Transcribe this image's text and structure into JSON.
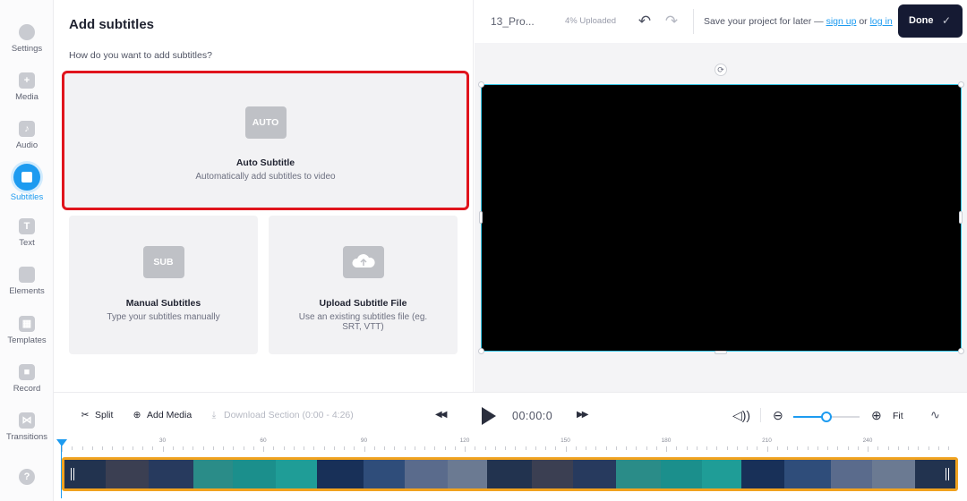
{
  "nav": {
    "items": [
      {
        "label": "Settings"
      },
      {
        "label": "Media"
      },
      {
        "label": "Audio"
      },
      {
        "label": "Subtitles"
      },
      {
        "label": "Text"
      },
      {
        "label": "Elements"
      },
      {
        "label": "Templates"
      },
      {
        "label": "Record"
      },
      {
        "label": "Transitions"
      }
    ],
    "help_icon": "?",
    "active": "Subtitles"
  },
  "panel": {
    "title": "Add subtitles",
    "question": "How do you want to add subtitles?",
    "options": [
      {
        "badge": "AUTO",
        "title": "Auto Subtitle",
        "desc": "Automatically add subtitles to video"
      },
      {
        "badge": "SUB",
        "title": "Manual Subtitles",
        "desc": "Type your subtitles manually"
      },
      {
        "badge": "",
        "title": "Upload Subtitle File",
        "desc": "Use an existing subtitles file (eg. SRT, VTT)"
      }
    ]
  },
  "topbar": {
    "project_name": "13_Pro...",
    "upload_status": "4% Uploaded",
    "save_prefix": "Save your project for later — ",
    "sign_up": "sign up",
    "or": " or ",
    "log_in": "log in",
    "done_label": "Done"
  },
  "toolbar": {
    "split_label": "Split",
    "add_media_label": "Add Media",
    "download_label": "Download Section (0:00 - 4:26)",
    "time": "00:00:0",
    "fit_label": "Fit"
  },
  "timeline": {
    "ticks": [
      "30",
      "60",
      "90",
      "120",
      "150",
      "180",
      "210",
      "240"
    ],
    "zoom_level": 0.5
  },
  "colors": {
    "accent": "#1d9bf0",
    "highlight": "#e0141c",
    "track_border": "#f0a21f",
    "done_bg": "#151a33"
  }
}
